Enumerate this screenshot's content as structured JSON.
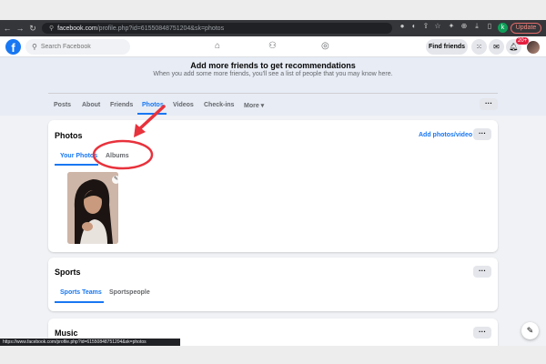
{
  "browser": {
    "url_host": "facebook.com",
    "url_path": "/profile.php?id=61550848751204&sk=photos",
    "update_label": "Update",
    "profile_letter": "k",
    "status_url": "https://www.facebook.com/profile.php?id=61550848751204&sk=photos"
  },
  "header": {
    "search_placeholder": "Search Facebook",
    "find_friends": "Find friends",
    "notif_count": "20+"
  },
  "banner": {
    "title": "Add more friends to get recommendations",
    "subtitle": "When you add some more friends, you'll see a list of people that you may know here."
  },
  "profile_tabs": [
    {
      "label": "Posts"
    },
    {
      "label": "About"
    },
    {
      "label": "Friends"
    },
    {
      "label": "Photos"
    },
    {
      "label": "Videos"
    },
    {
      "label": "Check-ins"
    },
    {
      "label": "More ▾"
    }
  ],
  "photos": {
    "title": "Photos",
    "add_label": "Add photos/video",
    "tab_your_photos": "Your Photos",
    "tab_albums": "Albums"
  },
  "sports": {
    "title": "Sports",
    "tab_teams": "Sports Teams",
    "tab_people": "Sportspeople"
  },
  "music": {
    "title": "Music"
  },
  "more_dots": "···",
  "colors": {
    "fb_blue": "#1877f2",
    "annotation_red": "#e8323c"
  }
}
